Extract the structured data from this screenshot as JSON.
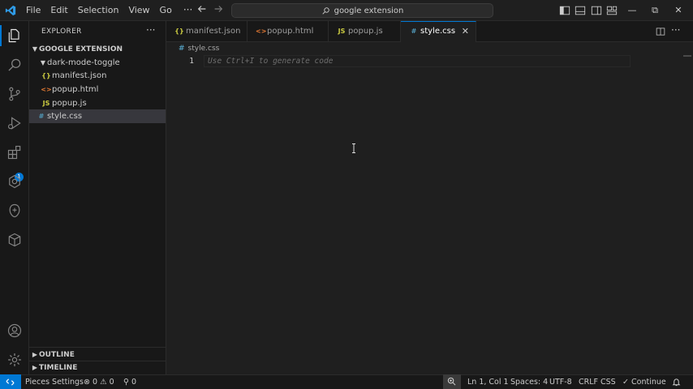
{
  "titlebar": {
    "menu": [
      "File",
      "Edit",
      "Selection",
      "View",
      "Go"
    ],
    "more": "···",
    "search_text": "google extension",
    "window_controls": {
      "minimize": "—",
      "restore": "⧉",
      "close": "✕"
    }
  },
  "activity_badge": "1",
  "explorer": {
    "title": "EXPLORER",
    "more": "···",
    "workspace": "GOOGLE EXTENSION",
    "folder": "dark-mode-toggle",
    "files": [
      {
        "icon": "{}",
        "name": "manifest.json"
      },
      {
        "icon": "<>",
        "name": "popup.html"
      },
      {
        "icon": "JS",
        "name": "popup.js"
      }
    ],
    "root_file": {
      "icon": "#",
      "name": "style.css"
    },
    "outline": "OUTLINE",
    "timeline": "TIMELINE"
  },
  "tabs": [
    {
      "icon": "{}",
      "label": "manifest.json"
    },
    {
      "icon": "<>",
      "label": "popup.html"
    },
    {
      "icon": "JS",
      "label": "popup.js"
    },
    {
      "icon": "#",
      "label": "style.css",
      "close": "✕"
    }
  ],
  "editor": {
    "breadcrumb_icon": "#",
    "breadcrumb": "style.css",
    "line_number": "1",
    "ghost_text": "Use Ctrl+I to generate code"
  },
  "statusbar": {
    "pieces": "Pieces Settings",
    "errors": "0",
    "warnings": "0",
    "ports": "0",
    "position": "Ln 1, Col 1",
    "spaces": "Spaces: 4",
    "encoding": "UTF-8",
    "eol": "CRLF",
    "language": "CSS",
    "continue": "Continue"
  },
  "colors": {
    "accent": "#0078d4",
    "background": "#1e1e1e",
    "sidebar": "#181818",
    "selection": "#37373d"
  }
}
